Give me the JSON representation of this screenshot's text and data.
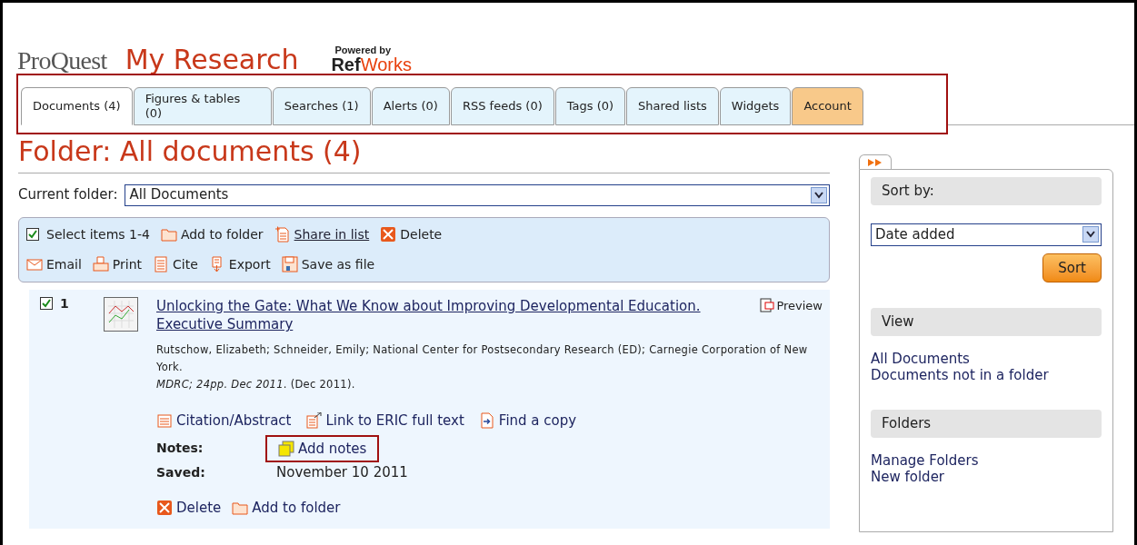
{
  "header": {
    "logo": "ProQuest",
    "title": "My Research",
    "powered_by": "Powered by",
    "refworks_a": "Ref",
    "refworks_b": "Works"
  },
  "tabs": [
    {
      "label": "Documents (4)",
      "selected": true,
      "kind": "normal"
    },
    {
      "label": "Figures & tables (0)",
      "selected": false,
      "kind": "normal"
    },
    {
      "label": "Searches (1)",
      "selected": false,
      "kind": "normal"
    },
    {
      "label": "Alerts (0)",
      "selected": false,
      "kind": "normal"
    },
    {
      "label": "RSS feeds (0)",
      "selected": false,
      "kind": "normal"
    },
    {
      "label": "Tags (0)",
      "selected": false,
      "kind": "normal"
    },
    {
      "label": "Shared lists",
      "selected": false,
      "kind": "normal"
    },
    {
      "label": "Widgets",
      "selected": false,
      "kind": "normal"
    },
    {
      "label": "Account",
      "selected": false,
      "kind": "account"
    }
  ],
  "heading": "Folder: All documents (4)",
  "folder": {
    "label": "Current folder:",
    "value": "All Documents"
  },
  "toolbar": {
    "select_all": {
      "label": "Select items 1-4",
      "checked": true
    },
    "row1": [
      {
        "label": "Add to folder",
        "link": false
      },
      {
        "label": "Share in list",
        "link": true
      },
      {
        "label": "Delete",
        "link": false
      }
    ],
    "row2": [
      {
        "label": "Email"
      },
      {
        "label": "Print"
      },
      {
        "label": "Cite"
      },
      {
        "label": "Export"
      },
      {
        "label": "Save as file"
      }
    ]
  },
  "documents": [
    {
      "checked": true,
      "number": "1",
      "title": "Unlocking the Gate: What We Know about Improving Developmental Education. Executive Summary",
      "preview": "Preview",
      "authors": "Rutschow, Elizabeth; Schneider, Emily; National Center for Postsecondary Research (ED); Carnegie Corporation of New York.",
      "source": "*MDRC; 24pp. Dec 2011*. (Dec 2011).",
      "links": [
        "Citation/Abstract",
        "Link to ERIC full text",
        "Find a copy"
      ],
      "notes_label": "Notes:",
      "add_notes": "Add notes",
      "saved_label": "Saved:",
      "saved": "November 10 2011",
      "actions": [
        "Delete",
        "Add to folder"
      ]
    }
  ],
  "sidebar": {
    "sort": {
      "title": "Sort by:",
      "value": "Date added",
      "button": "Sort"
    },
    "view": {
      "title": "View",
      "items": [
        "All Documents",
        "Documents not in a folder"
      ]
    },
    "folders": {
      "title": "Folders",
      "items": [
        "Manage Folders",
        "New folder"
      ]
    }
  }
}
